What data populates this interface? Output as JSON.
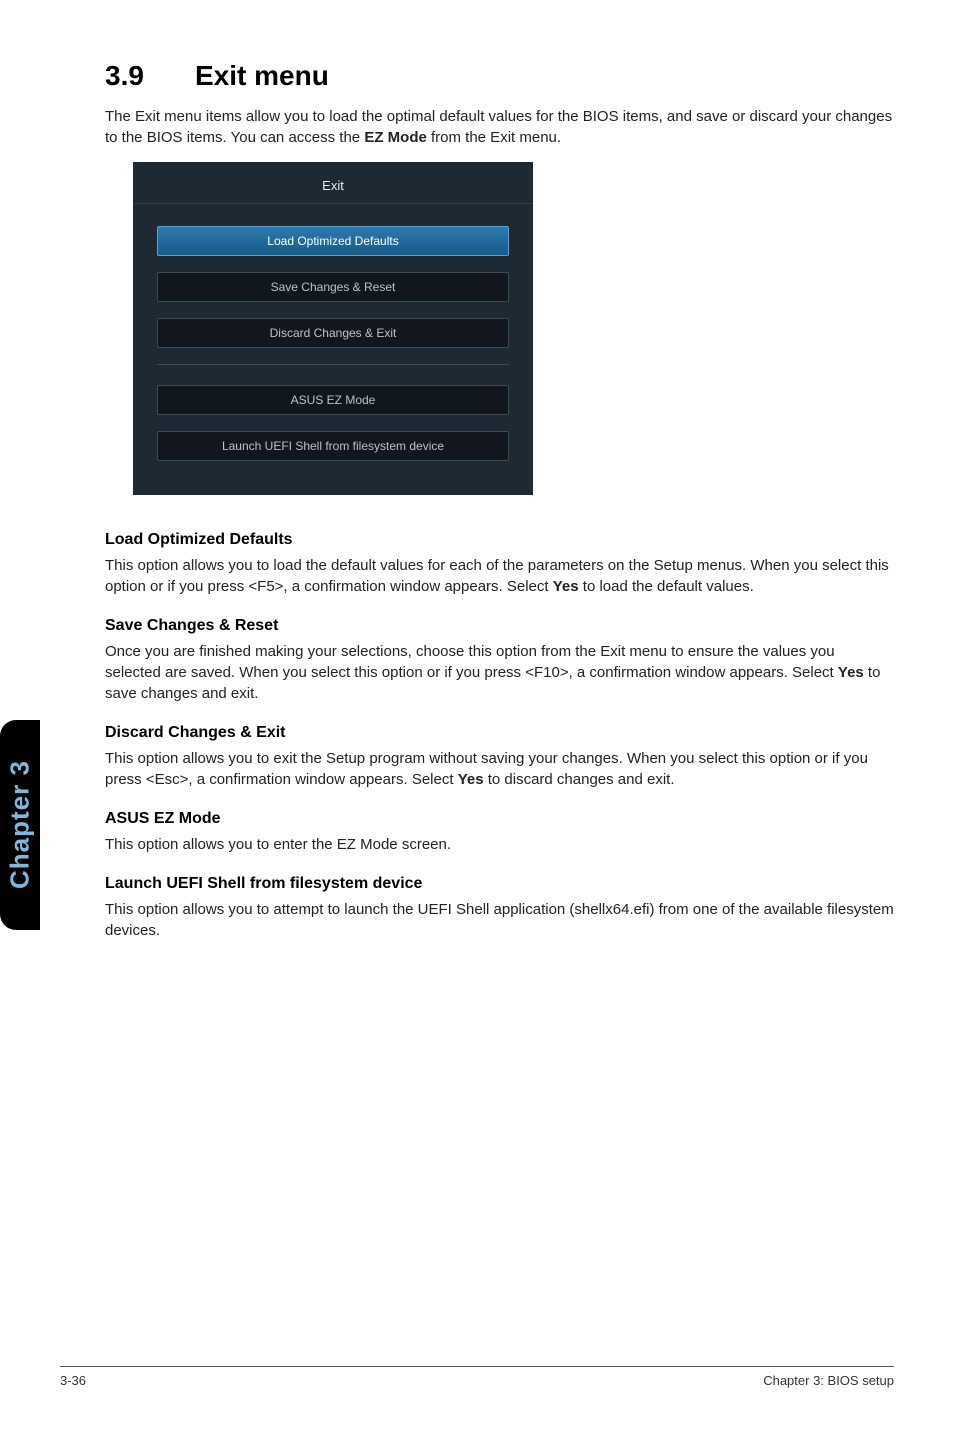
{
  "section": {
    "number": "3.9",
    "title": "Exit menu"
  },
  "intro_pre": "The Exit menu items allow you to load the optimal default values for the BIOS items, and save or discard your changes to the BIOS items. You can access the ",
  "intro_bold": "EZ Mode",
  "intro_post": " from the Exit menu.",
  "bios": {
    "header": "Exit",
    "buttons": [
      "Load Optimized Defaults",
      "Save Changes & Reset",
      "Discard Changes & Exit",
      "ASUS EZ Mode",
      "Launch UEFI Shell from filesystem device"
    ]
  },
  "items": {
    "load": {
      "heading": "Load Optimized Defaults",
      "p_pre": "This option allows you to load the default values for each of the parameters on the Setup menus. When you select this option or if you press <F5>, a confirmation window appears. Select ",
      "p_bold": "Yes",
      "p_post": " to load the default values."
    },
    "save": {
      "heading": "Save Changes & Reset",
      "p_pre": "Once you are finished making your selections, choose this option from the Exit menu to ensure the values you selected are saved. When you select this option or if you press <F10>, a confirmation window appears. Select ",
      "p_bold": "Yes",
      "p_post": " to save changes and exit."
    },
    "discard": {
      "heading": "Discard Changes & Exit",
      "p_pre": "This option allows you to exit the Setup program without saving your changes. When you select this option or if you press <Esc>, a confirmation window appears. Select ",
      "p_bold": "Yes",
      "p_post": " to discard changes and exit."
    },
    "ez": {
      "heading": "ASUS EZ Mode",
      "p": "This option allows you to enter the EZ Mode screen."
    },
    "uefi": {
      "heading": "Launch UEFI Shell from filesystem device",
      "p": "This option allows you to attempt to launch the UEFI Shell application (shellx64.efi) from one of the available filesystem devices."
    }
  },
  "sidebar": "Chapter 3",
  "footer": {
    "left": "3-36",
    "right": "Chapter 3: BIOS setup"
  }
}
